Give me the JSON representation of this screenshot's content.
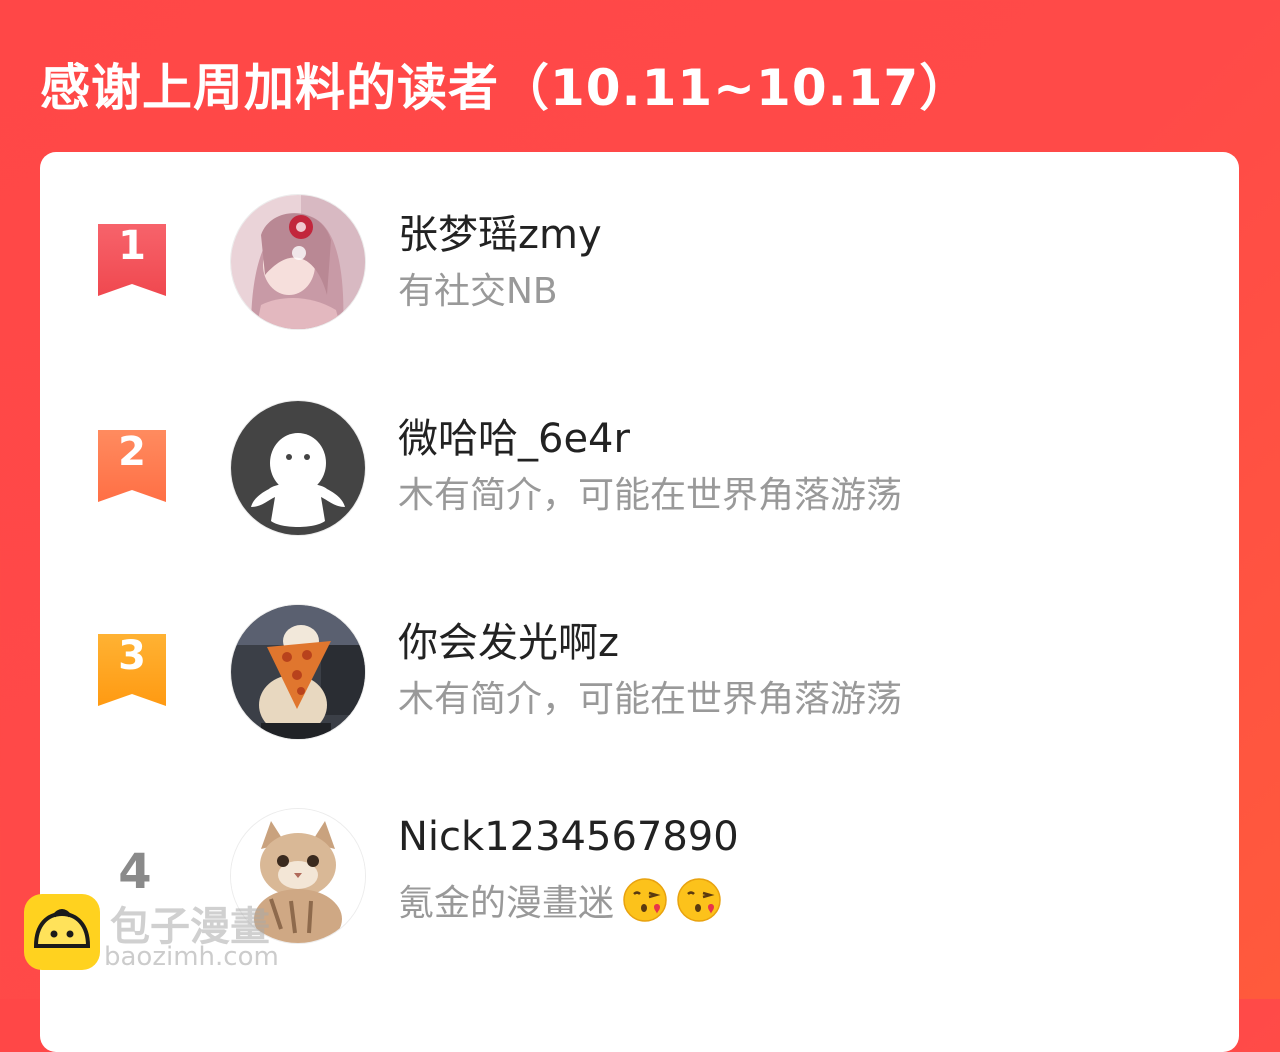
{
  "header": {
    "title": "感谢上周加料的读者（10.11~10.17）"
  },
  "readers": [
    {
      "rank": "1",
      "name": "张梦瑶zmy",
      "bio": "有社交NB",
      "badge_color": "#f4585e"
    },
    {
      "rank": "2",
      "name": "微哈哈_6e4r",
      "bio": "木有简介，可能在世界角落游荡",
      "badge_color": "#ff7a4e"
    },
    {
      "rank": "3",
      "name": "你会发光啊z",
      "bio": "木有简介，可能在世界角落游荡",
      "badge_color": "#ffa21a"
    },
    {
      "rank": "4",
      "name": "Nick1234567890",
      "bio": "氪金的漫畫迷",
      "bio_emojis": [
        "kissing-face-emoji",
        "kissing-face-emoji"
      ]
    }
  ],
  "watermark": {
    "title": "包子漫畫",
    "url": "baozimh.com",
    "logo": "bun-mascot-icon"
  },
  "colors": {
    "background": "#ff4747",
    "card": "#ffffff",
    "name_text": "#222222",
    "bio_text": "#999999"
  }
}
